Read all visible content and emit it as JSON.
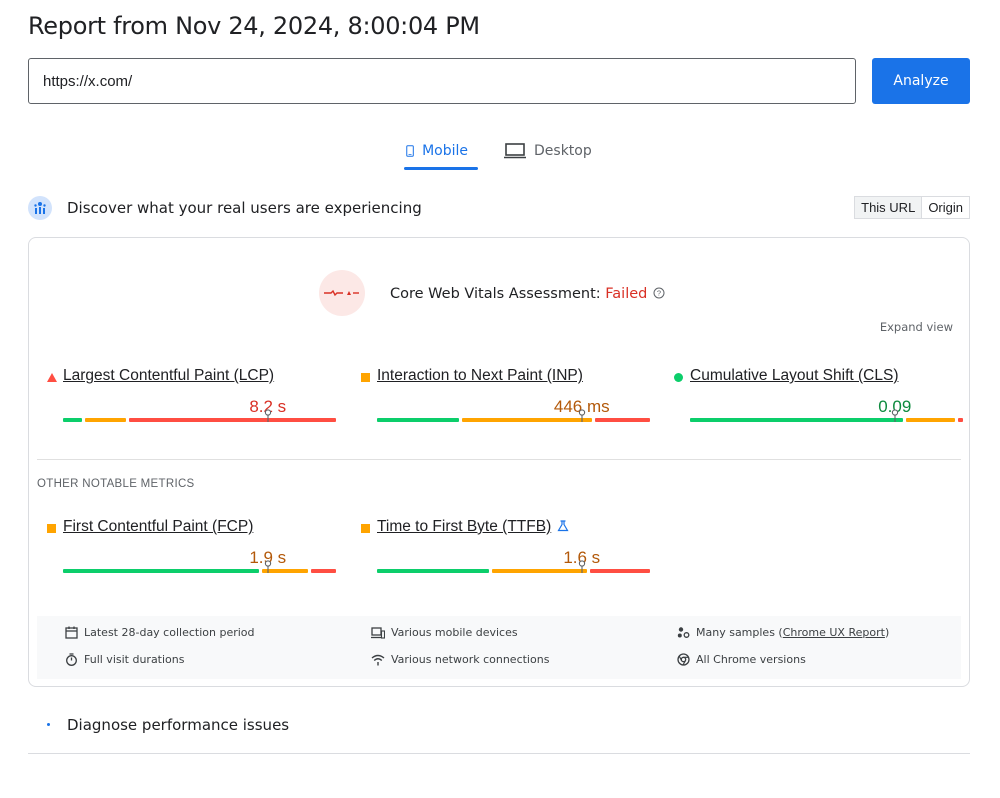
{
  "page_title": "Report from Nov 24, 2024, 8:00:04 PM",
  "url_input": {
    "value": "https://x.com/"
  },
  "analyze_label": "Analyze",
  "tabs": [
    {
      "label": "Mobile",
      "active": true,
      "icon": "phone-icon"
    },
    {
      "label": "Desktop",
      "active": false,
      "icon": "laptop-icon"
    }
  ],
  "discover": {
    "title": "Discover what your real users are experiencing",
    "toggle": [
      "This URL",
      "Origin"
    ],
    "selected": "This URL"
  },
  "assessment": {
    "label": "Core Web Vitals Assessment: ",
    "status": "Failed",
    "expand_label": "Expand view"
  },
  "core_metrics": [
    {
      "name": "Largest Contentful Paint (LCP)",
      "value": "8.2 s",
      "rating": "poor",
      "marker_icon": "triangle-icon",
      "value_color": "#d93025",
      "distribution": {
        "good": 0.08,
        "ni": 0.16,
        "poor": 0.76
      },
      "percentile_position": 0.75
    },
    {
      "name": "Interaction to Next Paint (INP)",
      "value": "446 ms",
      "rating": "needs-improvement",
      "marker_icon": "square-icon",
      "value_color": "#b3590a",
      "distribution": {
        "good": 0.31,
        "ni": 0.49,
        "poor": 0.2
      },
      "percentile_position": 0.75
    },
    {
      "name": "Cumulative Layout Shift (CLS)",
      "value": "0.09",
      "rating": "good",
      "marker_icon": "circle-icon",
      "value_color": "#0d8a3e",
      "distribution": {
        "good": 0.79,
        "ni": 0.19,
        "poor": 0.02
      },
      "percentile_position": 0.75
    }
  ],
  "other_label": "OTHER NOTABLE METRICS",
  "other_metrics": [
    {
      "name": "First Contentful Paint (FCP)",
      "value": "1.9 s",
      "rating": "needs-improvement",
      "marker_icon": "square-icon",
      "value_color": "#b3590a",
      "distribution": {
        "good": 0.73,
        "ni": 0.18,
        "poor": 0.09
      },
      "percentile_position": 0.75
    },
    {
      "name": "Time to First Byte (TTFB)",
      "value": "1.6 s",
      "rating": "needs-improvement",
      "marker_icon": "square-icon",
      "value_color": "#b3590a",
      "experimental_icon": "flask-icon",
      "distribution": {
        "good": 0.42,
        "ni": 0.36,
        "poor": 0.22
      },
      "percentile_position": 0.75
    }
  ],
  "info": {
    "collection_period": "Latest 28-day collection period",
    "visit_durations": "Full visit durations",
    "devices": "Various mobile devices",
    "network": "Various network connections",
    "samples_prefix": "Many samples (",
    "samples_link": "Chrome UX Report",
    "samples_suffix": ")",
    "chrome_versions": "All Chrome versions"
  },
  "diagnose_title": "Diagnose performance issues",
  "colors": {
    "accent": "#1a73e8",
    "good": "#0cce6b",
    "needs_improvement": "#ffa400",
    "poor": "#ff4e42",
    "failed_text": "#d93025"
  }
}
